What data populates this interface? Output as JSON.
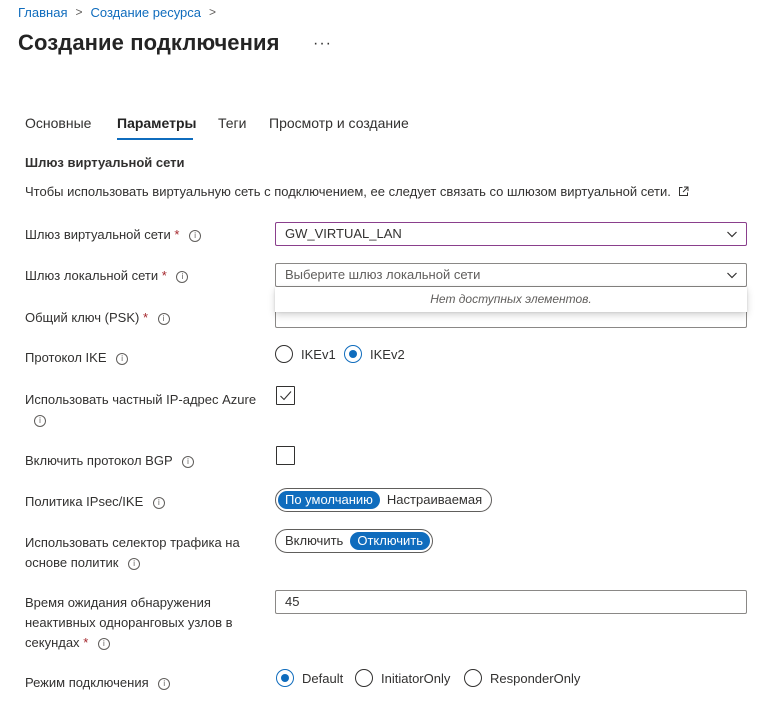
{
  "breadcrumb": {
    "home": "Главная",
    "create_resource": "Создание ресурса",
    "separator": ">"
  },
  "page": {
    "title": "Создание подключения",
    "more": "···"
  },
  "tabs": [
    {
      "label": "Основные"
    },
    {
      "label": "Параметры",
      "active": true
    },
    {
      "label": "Теги"
    },
    {
      "label": "Просмотр и создание"
    }
  ],
  "section": {
    "title": "Шлюз виртуальной сети",
    "description": "Чтобы использовать виртуальную сеть с подключением, ее следует связать со шлюзом виртуальной сети."
  },
  "fields": {
    "vnet_gateway": {
      "label": "Шлюз виртуальной сети",
      "required": "*",
      "value": "GW_VIRTUAL_LAN"
    },
    "local_gateway": {
      "label": "Шлюз локальной сети",
      "required": "*",
      "placeholder": "Выберите шлюз локальной сети",
      "empty_message": "Нет доступных элементов."
    },
    "psk": {
      "label": "Общий ключ (PSK)",
      "required": "*",
      "value": ""
    },
    "ike": {
      "label": "Протокол IKE",
      "options": [
        "IKEv1",
        "IKEv2"
      ],
      "selected": "IKEv2"
    },
    "private_ip": {
      "label": "Использовать частный IP-адрес Azure",
      "checked": true
    },
    "bgp": {
      "label": "Включить протокол BGP",
      "checked": false
    },
    "ipsec_policy": {
      "label": "Политика IPsec/IKE",
      "options": [
        "По умолчанию",
        "Настраиваемая"
      ],
      "selected": "По умолчанию"
    },
    "policy_selector": {
      "label_line1": "Использовать селектор трафика на",
      "label_line2": "основе политик",
      "options": [
        "Включить",
        "Отключить"
      ],
      "selected": "Отключить"
    },
    "dpd_timeout": {
      "label_line1": "Время ожидания обнаружения",
      "label_line2": "неактивных одноранговых узлов в",
      "label_line3": "секундах",
      "required": "*",
      "value": "45"
    },
    "connection_mode": {
      "label": "Режим подключения",
      "options": [
        "Default",
        "InitiatorOnly",
        "ResponderOnly"
      ],
      "selected": "Default"
    }
  },
  "icons": {
    "info": "info-icon",
    "external": "external-link-icon",
    "chevron": "chevron-down-icon",
    "check": "checkmark-icon"
  },
  "colors": {
    "accent": "#0f6cbd",
    "required": "#a4262c",
    "focus_border": "#8a3f8c"
  }
}
